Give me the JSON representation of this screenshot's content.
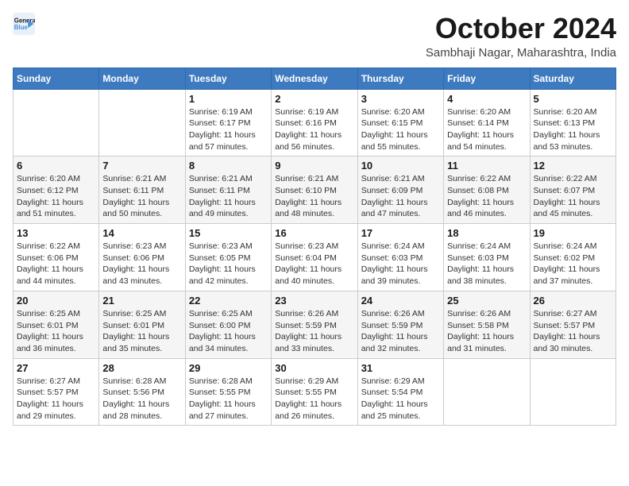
{
  "logo": {
    "line1": "General",
    "line2": "Blue"
  },
  "title": "October 2024",
  "subtitle": "Sambhaji Nagar, Maharashtra, India",
  "days_of_week": [
    "Sunday",
    "Monday",
    "Tuesday",
    "Wednesday",
    "Thursday",
    "Friday",
    "Saturday"
  ],
  "weeks": [
    [
      {
        "day": "",
        "detail": ""
      },
      {
        "day": "",
        "detail": ""
      },
      {
        "day": "1",
        "detail": "Sunrise: 6:19 AM\nSunset: 6:17 PM\nDaylight: 11 hours\nand 57 minutes."
      },
      {
        "day": "2",
        "detail": "Sunrise: 6:19 AM\nSunset: 6:16 PM\nDaylight: 11 hours\nand 56 minutes."
      },
      {
        "day": "3",
        "detail": "Sunrise: 6:20 AM\nSunset: 6:15 PM\nDaylight: 11 hours\nand 55 minutes."
      },
      {
        "day": "4",
        "detail": "Sunrise: 6:20 AM\nSunset: 6:14 PM\nDaylight: 11 hours\nand 54 minutes."
      },
      {
        "day": "5",
        "detail": "Sunrise: 6:20 AM\nSunset: 6:13 PM\nDaylight: 11 hours\nand 53 minutes."
      }
    ],
    [
      {
        "day": "6",
        "detail": "Sunrise: 6:20 AM\nSunset: 6:12 PM\nDaylight: 11 hours\nand 51 minutes."
      },
      {
        "day": "7",
        "detail": "Sunrise: 6:21 AM\nSunset: 6:11 PM\nDaylight: 11 hours\nand 50 minutes."
      },
      {
        "day": "8",
        "detail": "Sunrise: 6:21 AM\nSunset: 6:11 PM\nDaylight: 11 hours\nand 49 minutes."
      },
      {
        "day": "9",
        "detail": "Sunrise: 6:21 AM\nSunset: 6:10 PM\nDaylight: 11 hours\nand 48 minutes."
      },
      {
        "day": "10",
        "detail": "Sunrise: 6:21 AM\nSunset: 6:09 PM\nDaylight: 11 hours\nand 47 minutes."
      },
      {
        "day": "11",
        "detail": "Sunrise: 6:22 AM\nSunset: 6:08 PM\nDaylight: 11 hours\nand 46 minutes."
      },
      {
        "day": "12",
        "detail": "Sunrise: 6:22 AM\nSunset: 6:07 PM\nDaylight: 11 hours\nand 45 minutes."
      }
    ],
    [
      {
        "day": "13",
        "detail": "Sunrise: 6:22 AM\nSunset: 6:06 PM\nDaylight: 11 hours\nand 44 minutes."
      },
      {
        "day": "14",
        "detail": "Sunrise: 6:23 AM\nSunset: 6:06 PM\nDaylight: 11 hours\nand 43 minutes."
      },
      {
        "day": "15",
        "detail": "Sunrise: 6:23 AM\nSunset: 6:05 PM\nDaylight: 11 hours\nand 42 minutes."
      },
      {
        "day": "16",
        "detail": "Sunrise: 6:23 AM\nSunset: 6:04 PM\nDaylight: 11 hours\nand 40 minutes."
      },
      {
        "day": "17",
        "detail": "Sunrise: 6:24 AM\nSunset: 6:03 PM\nDaylight: 11 hours\nand 39 minutes."
      },
      {
        "day": "18",
        "detail": "Sunrise: 6:24 AM\nSunset: 6:03 PM\nDaylight: 11 hours\nand 38 minutes."
      },
      {
        "day": "19",
        "detail": "Sunrise: 6:24 AM\nSunset: 6:02 PM\nDaylight: 11 hours\nand 37 minutes."
      }
    ],
    [
      {
        "day": "20",
        "detail": "Sunrise: 6:25 AM\nSunset: 6:01 PM\nDaylight: 11 hours\nand 36 minutes."
      },
      {
        "day": "21",
        "detail": "Sunrise: 6:25 AM\nSunset: 6:01 PM\nDaylight: 11 hours\nand 35 minutes."
      },
      {
        "day": "22",
        "detail": "Sunrise: 6:25 AM\nSunset: 6:00 PM\nDaylight: 11 hours\nand 34 minutes."
      },
      {
        "day": "23",
        "detail": "Sunrise: 6:26 AM\nSunset: 5:59 PM\nDaylight: 11 hours\nand 33 minutes."
      },
      {
        "day": "24",
        "detail": "Sunrise: 6:26 AM\nSunset: 5:59 PM\nDaylight: 11 hours\nand 32 minutes."
      },
      {
        "day": "25",
        "detail": "Sunrise: 6:26 AM\nSunset: 5:58 PM\nDaylight: 11 hours\nand 31 minutes."
      },
      {
        "day": "26",
        "detail": "Sunrise: 6:27 AM\nSunset: 5:57 PM\nDaylight: 11 hours\nand 30 minutes."
      }
    ],
    [
      {
        "day": "27",
        "detail": "Sunrise: 6:27 AM\nSunset: 5:57 PM\nDaylight: 11 hours\nand 29 minutes."
      },
      {
        "day": "28",
        "detail": "Sunrise: 6:28 AM\nSunset: 5:56 PM\nDaylight: 11 hours\nand 28 minutes."
      },
      {
        "day": "29",
        "detail": "Sunrise: 6:28 AM\nSunset: 5:55 PM\nDaylight: 11 hours\nand 27 minutes."
      },
      {
        "day": "30",
        "detail": "Sunrise: 6:29 AM\nSunset: 5:55 PM\nDaylight: 11 hours\nand 26 minutes."
      },
      {
        "day": "31",
        "detail": "Sunrise: 6:29 AM\nSunset: 5:54 PM\nDaylight: 11 hours\nand 25 minutes."
      },
      {
        "day": "",
        "detail": ""
      },
      {
        "day": "",
        "detail": ""
      }
    ]
  ]
}
